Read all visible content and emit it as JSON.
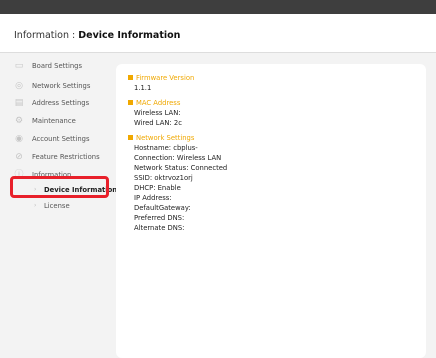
{
  "header": {
    "section": "Information : ",
    "page": "Device Information"
  },
  "sidebar": {
    "items": [
      {
        "label": "Board Settings",
        "icon": "board-icon"
      },
      {
        "label": "Network Settings",
        "icon": "network-icon"
      },
      {
        "label": "Address Settings",
        "icon": "address-icon"
      },
      {
        "label": "Maintenance",
        "icon": "maintenance-icon"
      },
      {
        "label": "Account Settings",
        "icon": "account-icon"
      },
      {
        "label": "Feature Restrictions",
        "icon": "restriction-icon"
      },
      {
        "label": "Information",
        "icon": "info-icon"
      }
    ],
    "sub_items": [
      {
        "label": "Device Information",
        "active": true
      },
      {
        "label": "License",
        "active": false
      }
    ]
  },
  "content": {
    "firmware": {
      "title": "Firmware Version",
      "value": "1.1.1"
    },
    "mac": {
      "title": "MAC Address",
      "wireless": "Wireless LAN:",
      "wired": "Wired LAN: 2c"
    },
    "network": {
      "title": "Network Settings",
      "hostname": "Hostname: cbplus-",
      "connection": "Connection: Wireless LAN",
      "status": "Network Status: Connected",
      "ssid": "SSID: oktrvoz1orj",
      "dhcp": "DHCP: Enable",
      "ip": "IP Address:",
      "gateway": "DefaultGateway:",
      "preferred_dns": "Preferred DNS:",
      "alternate_dns": "Alternate DNS:"
    }
  },
  "colors": {
    "accent": "#f0a800",
    "highlight": "#e8202a",
    "topbar": "#3e3e3e"
  }
}
